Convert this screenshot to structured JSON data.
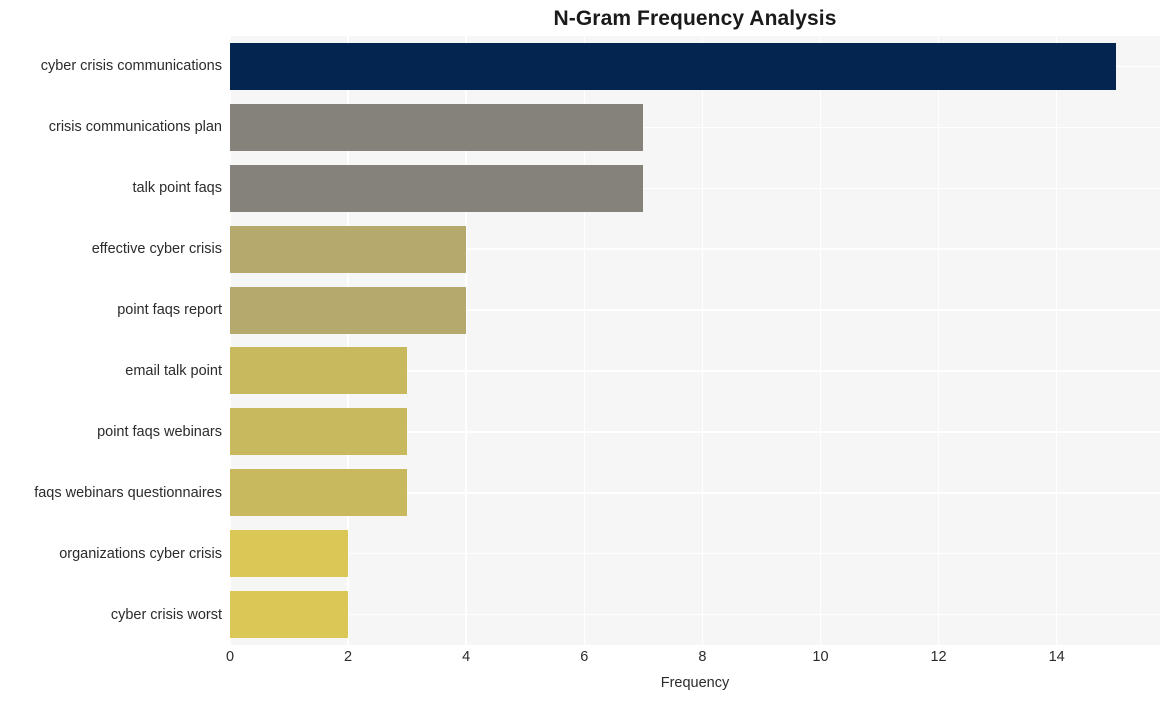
{
  "chart_data": {
    "type": "bar",
    "orientation": "horizontal",
    "title": "N-Gram Frequency Analysis",
    "xlabel": "Frequency",
    "ylabel": "",
    "categories": [
      "cyber crisis communications",
      "crisis communications plan",
      "talk point faqs",
      "effective cyber crisis",
      "point faqs report",
      "email talk point",
      "point faqs webinars",
      "faqs webinars questionnaires",
      "organizations cyber crisis",
      "cyber crisis worst"
    ],
    "values": [
      15,
      7,
      7,
      4,
      4,
      3,
      3,
      3,
      2,
      2
    ],
    "bar_colors": [
      "#04254f",
      "#85827c",
      "#85827c",
      "#b5a96d",
      "#b5a96d",
      "#c8b95f",
      "#c8b95f",
      "#c8b95f",
      "#dbc755",
      "#dbc755"
    ],
    "xlim": [
      0,
      15.75
    ],
    "xticks": [
      0,
      2,
      4,
      6,
      8,
      10,
      12,
      14
    ],
    "xtick_labels": [
      "0",
      "2",
      "4",
      "6",
      "8",
      "10",
      "12",
      "14"
    ],
    "grid": true,
    "grid_color": "#ffffff",
    "plot_background": "#f6f6f7",
    "figure_background": "#ffffff",
    "legend": null,
    "style": "whitegrid"
  }
}
